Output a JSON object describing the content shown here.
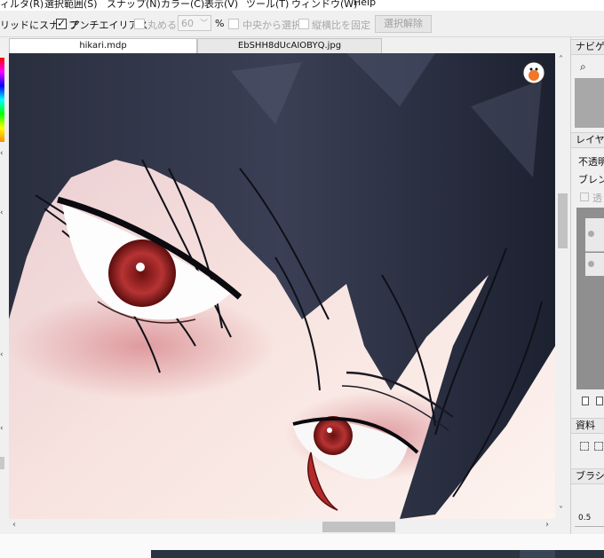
{
  "menu": {
    "items": [
      "ィルタ(R)",
      "選択範囲(S)",
      "スナップ(N)",
      "カラー(C)",
      "表示(V)",
      "ツール(T)",
      "ウィンドウ(W)",
      "Help"
    ]
  },
  "toolbar": {
    "grid_snap_label": "リッドにスナップ",
    "antialias_label": "アンチエイリアス",
    "antialias_checked": true,
    "round_label": "丸める",
    "round_value": "60",
    "round_unit": "%",
    "center_select_label": "中央から選択",
    "fix_ratio_label": "縦横比を固定",
    "clear_selection_label": "選択解除"
  },
  "tabs": [
    {
      "label": "hikari.mdp",
      "active": true
    },
    {
      "label": "EbSHH8dUcAIOBYQ.jpg",
      "active": false
    }
  ],
  "right_panel": {
    "navigator_title": "ナビゲー",
    "layer_title": "レイヤー",
    "opacity_label": "不透明",
    "blend_label": "ブレンド",
    "protect_label": "透",
    "material_title": "資料",
    "brush_title": "ブラシサ",
    "brush_value": "0.5"
  },
  "colors": {
    "canvas_bg": "#f2e6e4",
    "hair": "#1c2130",
    "iris": "#a52a2a",
    "taskbar": "#2b3542"
  },
  "icons": [
    "zoom-icon",
    "page-icon",
    "arrow-icon",
    "hue-strip-icon",
    "artist-avatar-icon"
  ]
}
